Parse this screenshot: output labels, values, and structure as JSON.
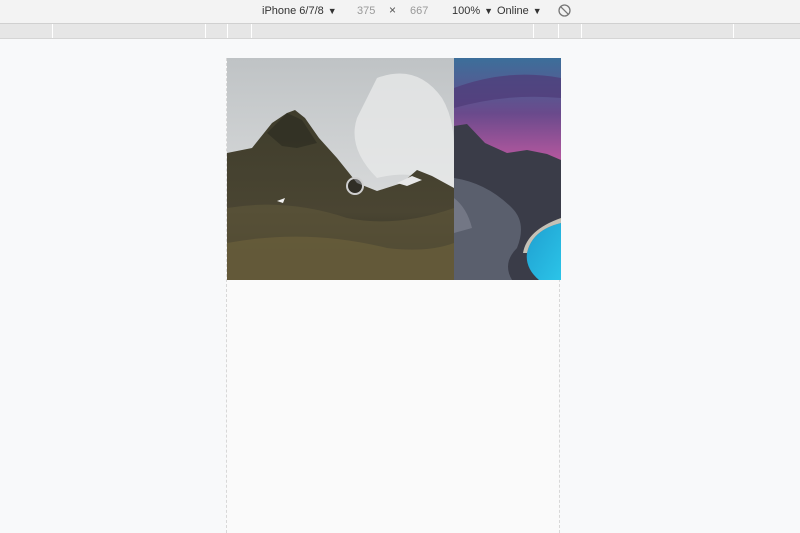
{
  "toolbar": {
    "device": "iPhone 6/7/8",
    "width": "375",
    "times": "×",
    "height": "667",
    "zoom": "100%",
    "network": "Online",
    "caret": "▼"
  },
  "icons": {
    "rotate": "rotate-icon",
    "cursor": "touch-cursor-indicator"
  },
  "colors": {
    "toolbar_bg": "#f3f3f3",
    "ruler_bg": "#e6e6e6",
    "page_bg": "#f8f9fa"
  }
}
